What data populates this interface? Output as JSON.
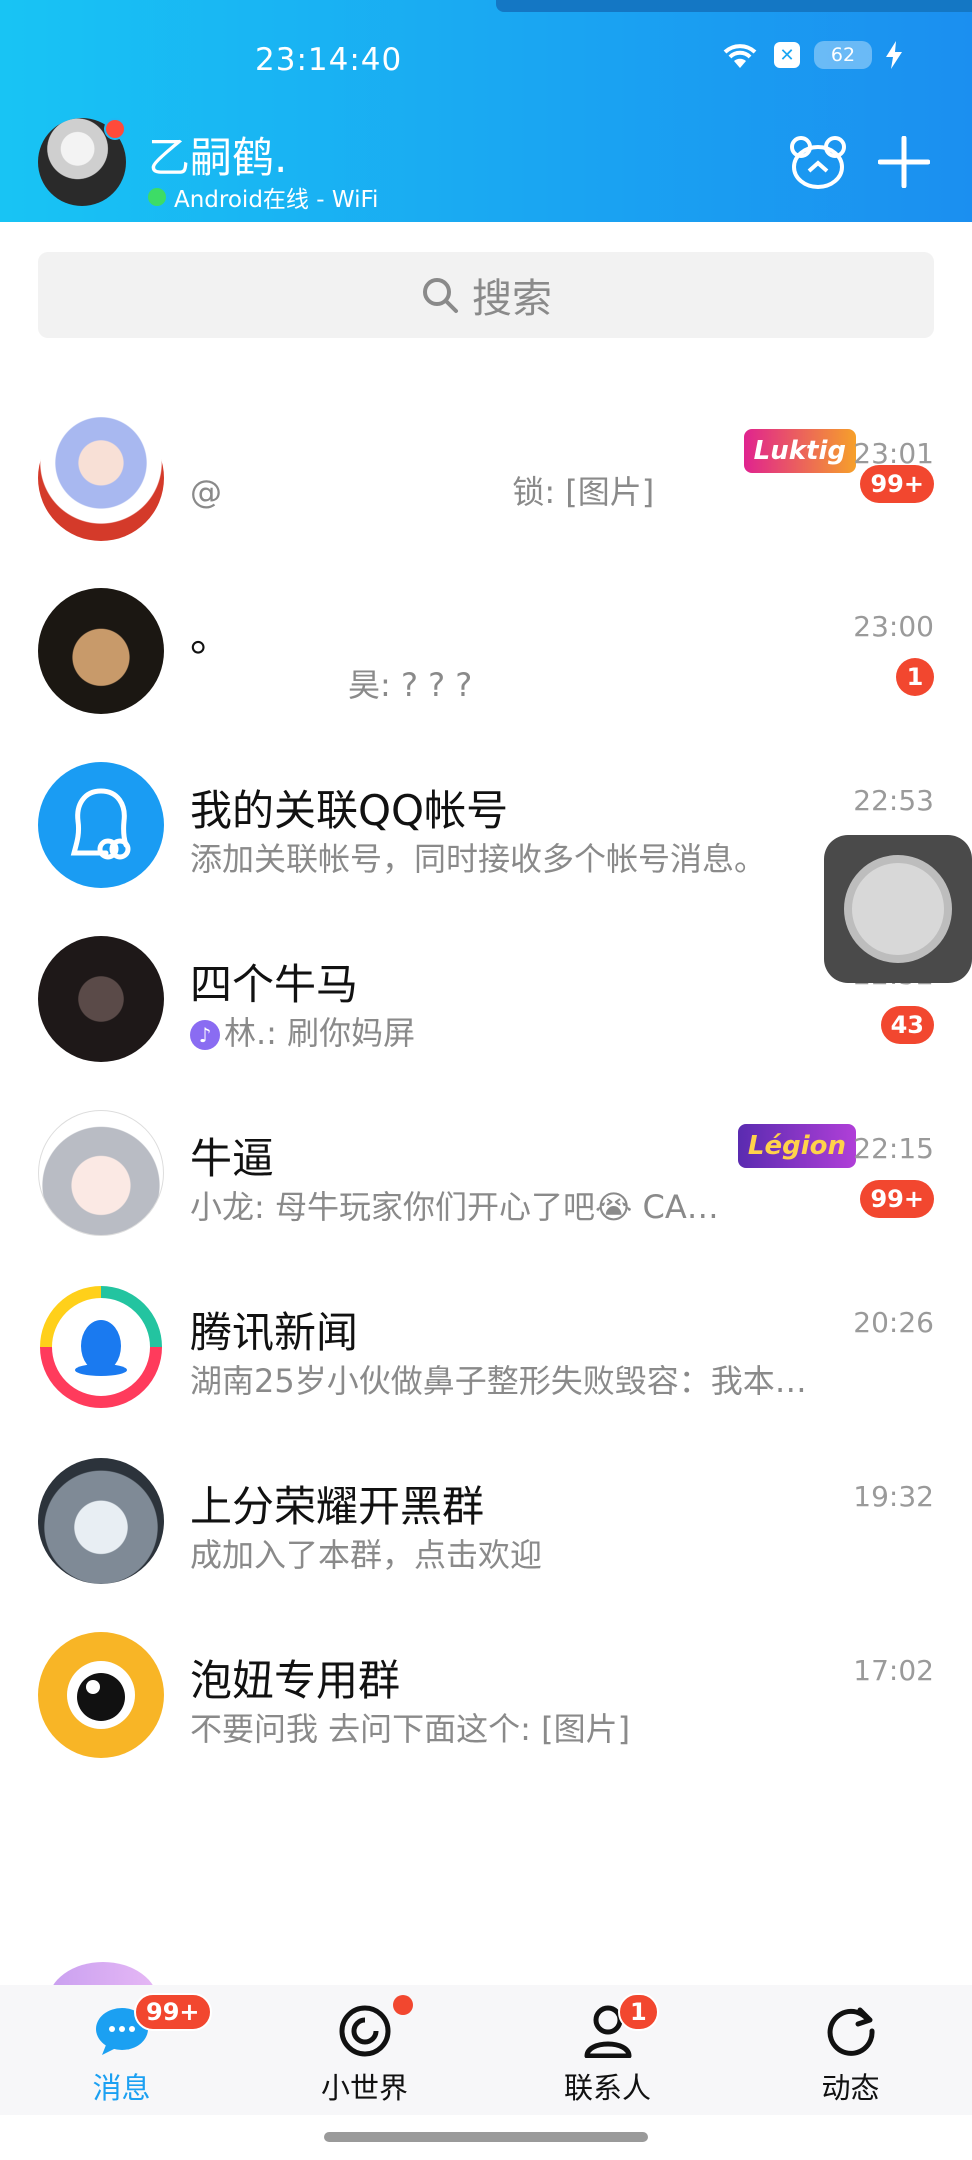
{
  "status_bar": {
    "time": "23:14:40",
    "battery": "62"
  },
  "profile": {
    "nickname": "乙嗣鹤.",
    "online_status": "Android在线 - WiFi"
  },
  "search": {
    "placeholder": "搜索"
  },
  "chats": [
    {
      "title": "",
      "preview_left": "@",
      "preview": "锁: [图片]",
      "time": "23:01",
      "badge": "99+",
      "tag": "Luktig",
      "tag_color": "#c72cc4"
    },
    {
      "title": "。",
      "preview": "昊: ? ? ?",
      "time": "23:00",
      "badge": "1"
    },
    {
      "title": "我的关联QQ帐号",
      "preview": "添加关联帐号，同时接收多个帐号消息。",
      "time": "22:53",
      "badge": ""
    },
    {
      "title": "四个牛马",
      "preview": "林.: 刷你妈屏",
      "time": "22:52",
      "badge": "43"
    },
    {
      "title": "牛逼",
      "preview": "小龙: 母牛玩家你们开心了吧😭 CA…",
      "time": "22:15",
      "badge": "99+",
      "tag": "Légion",
      "tag_color": "#7a3fd0"
    },
    {
      "title": "腾讯新闻",
      "preview": "湖南25岁小伙做鼻子整形失败毁容：我本…",
      "time": "20:26",
      "badge": ""
    },
    {
      "title": "上分荣耀开黑群",
      "preview": "成加入了本群，点击欢迎",
      "time": "19:32",
      "badge": ""
    },
    {
      "title": "泡妞专用群",
      "preview": "不要问我 去问下面这个: [图片]",
      "time": "17:02",
      "badge": ""
    }
  ],
  "bottom_nav": {
    "messages": {
      "label": "消息",
      "badge": "99+"
    },
    "world": {
      "label": "小世界"
    },
    "contacts": {
      "label": "联系人",
      "badge": "1"
    },
    "feed": {
      "label": "动态"
    }
  },
  "colors": {
    "accent": "#1ba0f2",
    "badge": "#f2472f"
  }
}
